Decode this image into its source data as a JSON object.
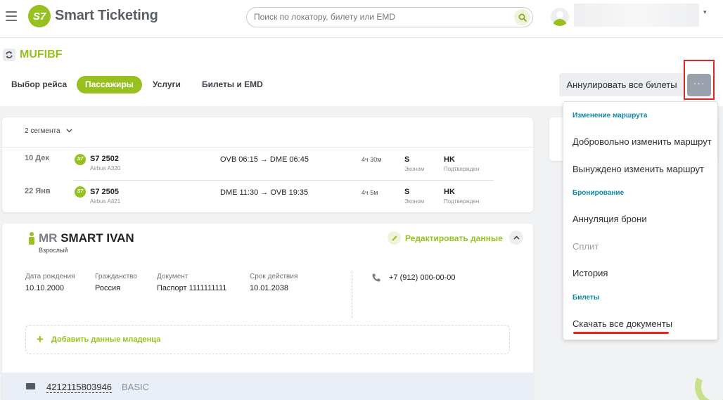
{
  "header": {
    "brand_logo_text": "S7",
    "brand_name": "Smart Ticketing",
    "search_placeholder": "Поиск по локатору, билету или EMD"
  },
  "booking": {
    "locator": "MUFIBF",
    "tabs": [
      {
        "label": "Выбор рейса",
        "active": false
      },
      {
        "label": "Пассажиры",
        "active": true
      },
      {
        "label": "Услуги",
        "active": false
      },
      {
        "label": "Билеты и EMD",
        "active": false
      }
    ],
    "cancel_all_label": "Аннулировать все билеты",
    "more_label": "···"
  },
  "flights": {
    "segments_label": "2 сегмента",
    "items": [
      {
        "date": "10 Дек",
        "airline_logo": "S7",
        "flight_no": "S7 2502",
        "aircraft": "Airbus A320",
        "route": "OVB 06:15 → DME 06:45",
        "duration": "4ч 30м",
        "class_code": "S",
        "class_name": "Эконом",
        "status_code": "HK",
        "status_name": "Подтвержден"
      },
      {
        "date": "22 Янв",
        "airline_logo": "S7",
        "flight_no": "S7 2505",
        "aircraft": "Airbus A321",
        "route": "DME 11:30 → OVB 19:35",
        "duration": "4ч 5м",
        "class_code": "S",
        "class_name": "Эконом",
        "status_code": "HK",
        "status_name": "Подтвержден"
      }
    ]
  },
  "passenger": {
    "title": "MR",
    "name": "SMART IVAN",
    "type": "Взрослый",
    "edit_label": "Редактировать данные",
    "fields": [
      {
        "label": "Дата рождения",
        "value": "10.10.2000"
      },
      {
        "label": "Гражданство",
        "value": "Россия"
      },
      {
        "label": "Документ",
        "value": "Паспорт 1111111111"
      },
      {
        "label": "Срок действия",
        "value": "10.01.2038"
      }
    ],
    "phone": "+7 (912) 000-00-00",
    "add_infant_label": "Добавить данные младенца",
    "ticket_number": "4212115803946",
    "fare": "BASIC"
  },
  "menu": {
    "section_route": "Изменение маршрута",
    "voluntary_change": "Добровольно изменить маршрут",
    "forced_change": "Вынуждено изменить маршрут",
    "section_booking": "Бронирование",
    "cancel_booking": "Аннуляция брони",
    "split": "Сплит",
    "history": "История",
    "section_tickets": "Билеты",
    "download_all": "Скачать все документы"
  },
  "colors": {
    "brand_green": "#96c11f",
    "section_teal": "#0e8aa6",
    "highlight_red": "#e0261f"
  }
}
